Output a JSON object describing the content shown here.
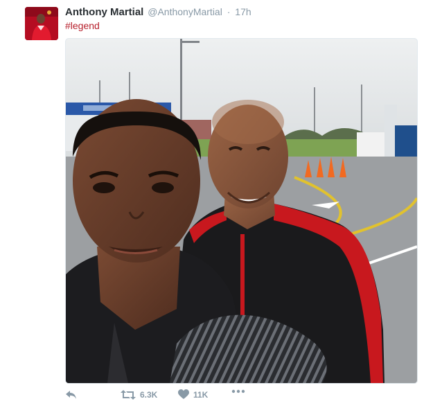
{
  "tweet": {
    "author_name": "Anthony Martial",
    "handle": "@AnthonyMartial",
    "separator": "·",
    "time": "17h",
    "text": "#legend",
    "hashtag": "#legend",
    "retweet_count": "6.3K",
    "like_count": "11K"
  },
  "icons": {
    "reply": "reply-icon",
    "retweet": "retweet-icon",
    "like": "heart-icon",
    "more": "more-icon"
  },
  "colors": {
    "hashtag": "#b61f2b",
    "muted": "#8899a6",
    "avatar_bg": "#c8102e"
  }
}
